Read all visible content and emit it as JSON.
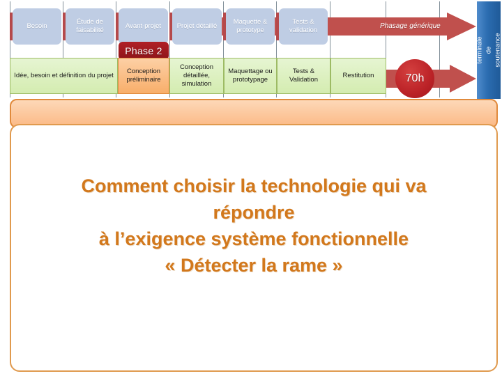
{
  "colors": {
    "phase_box_fill": "#bfcde4",
    "phase_connector": "#b5494b",
    "phase_tag": "#a01c22",
    "activity_fill": "#ddf0c2",
    "activity_border": "#9dbb64",
    "highlight_fill": "#fbbe86",
    "arrow_red": "#c0504d",
    "exam_blue": "#2f6fb5",
    "callout_border": "#e09a4e",
    "callout_text": "#d2781c",
    "peach_fill": "#fcc79a"
  },
  "timeline": {
    "generic_phases": [
      {
        "label": "Besoin"
      },
      {
        "label": "Étude de faisabilité"
      },
      {
        "label": "Avant-projet"
      },
      {
        "label": "Projet détaillé"
      },
      {
        "label": "Maquette & prototype"
      },
      {
        "label": "Tests & validation"
      }
    ],
    "phase_tag": "Phase 2",
    "activities": [
      {
        "label": "Idée, besoin et définition du projet",
        "highlight": false
      },
      {
        "label": "Conception préliminaire",
        "highlight": true
      },
      {
        "label": "Conception détaillée, simulation",
        "highlight": false
      },
      {
        "label": "Maquettage ou prototypage",
        "highlight": false
      },
      {
        "label": "Tests & Validation",
        "highlight": false
      },
      {
        "label": "Restitution",
        "highlight": false
      }
    ],
    "generic_arrow_label": "Phasage générique",
    "hours_badge": "70h",
    "exam_bar": {
      "line1": "Épreuve terminale de",
      "line2": "soutenance individuelle"
    }
  },
  "callout": {
    "lines": [
      "Comment choisir la technologie qui va",
      "répondre",
      "à l’exigence système fonctionnelle",
      "« Détecter la rame »"
    ],
    "line1": "Comment choisir la technologie qui va",
    "line2": "répondre",
    "line3": "à l’exigence système fonctionnelle",
    "line4": "« Détecter la rame »"
  }
}
